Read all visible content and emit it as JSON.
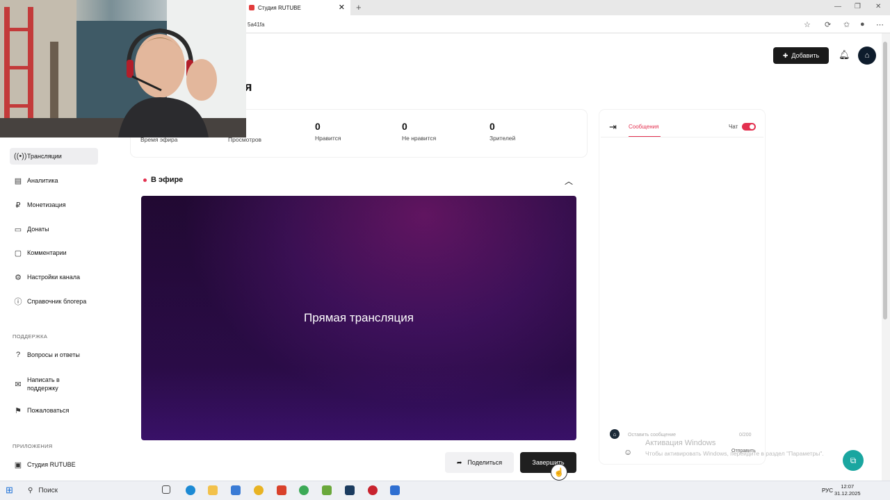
{
  "browser": {
    "tab_title": "Студия RUTUBE",
    "url_fragment": "5a41fa",
    "new_tab": "+",
    "close_tab": "✕",
    "window_controls": [
      "—",
      "❐",
      "✕"
    ]
  },
  "header": {
    "add_label": "Добавить",
    "title_fragment": "я"
  },
  "stats": [
    {
      "value": "",
      "label": "Время эфира"
    },
    {
      "value": "",
      "label": "Просмотров"
    },
    {
      "value": "0",
      "label": "Нравится"
    },
    {
      "value": "0",
      "label": "Не нравится"
    },
    {
      "value": "0",
      "label": "Зрителей"
    }
  ],
  "sidebar": {
    "items": [
      {
        "label": "Трансляции",
        "icon": "broadcast-icon",
        "active": true
      },
      {
        "label": "Аналитика",
        "icon": "analytics-icon"
      },
      {
        "label": "Монетизация",
        "icon": "ruble-icon"
      },
      {
        "label": "Донаты",
        "icon": "donate-icon"
      },
      {
        "label": "Комментарии",
        "icon": "comment-icon"
      },
      {
        "label": "Настройки канала",
        "icon": "gear-icon"
      },
      {
        "label": "Справочник блогера",
        "icon": "info-icon"
      }
    ],
    "support_heading": "ПОДДЕРЖКА",
    "support_items": [
      {
        "label": "Вопросы и ответы",
        "icon": "question-icon"
      },
      {
        "label": "Написать в поддержку",
        "icon": "mail-icon"
      },
      {
        "label": "Пожаловаться",
        "icon": "flag-icon"
      }
    ],
    "apps_heading": "ПРИЛОЖЕНИЯ",
    "apps_items": [
      {
        "label": "Студия RUTUBE",
        "icon": "app-icon"
      }
    ]
  },
  "live": {
    "status": "В эфире",
    "player_title": "Прямая трансляция",
    "share_label": "Поделиться",
    "end_label": "Завершить"
  },
  "chat": {
    "tab_label": "Сообщения",
    "toggle_label": "Чат",
    "toggle_on": true,
    "input_placeholder": "Оставить сообщение",
    "char_count": "0/200",
    "send_label": "Отправить"
  },
  "watermark": {
    "line1": "Активация Windows",
    "line2": "Чтобы активировать Windows, перейдите в раздел \"Параметры\"."
  },
  "taskbar": {
    "search_label": "Поиск",
    "lang": "РУС",
    "time": "12:07",
    "date": "31.12.2025"
  },
  "colors": {
    "accent": "#e3304f",
    "dark_button": "#1f1f1f"
  }
}
